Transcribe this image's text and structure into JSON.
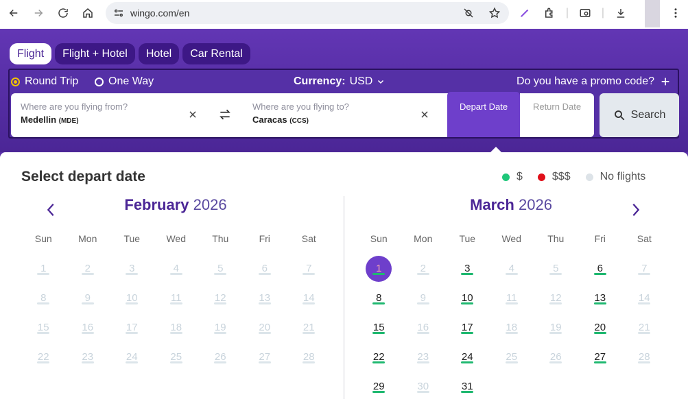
{
  "browser": {
    "url": "wingo.com/en"
  },
  "tabs": [
    {
      "label": "Flight",
      "active": true
    },
    {
      "label": "Flight + Hotel",
      "active": false
    },
    {
      "label": "Hotel",
      "active": false
    },
    {
      "label": "Car Rental",
      "active": false
    }
  ],
  "trip": {
    "round_trip": "Round Trip",
    "one_way": "One Way",
    "currency_label": "Currency:",
    "currency_value": "USD",
    "promo": "Do you have a promo code?"
  },
  "fields": {
    "from_placeholder": "Where are you flying from?",
    "from_city": "Medellin",
    "from_code": "(MDE)",
    "to_placeholder": "Where are you flying to?",
    "to_city": "Caracas",
    "to_code": "(CCS)",
    "depart": "Depart Date",
    "return": "Return Date",
    "search": "Search"
  },
  "calendar": {
    "title": "Select depart date",
    "legend": [
      "$",
      "$$$",
      "No flights"
    ],
    "legend_colors": [
      "#1fc77a",
      "#e0101a",
      "#dde3e8"
    ],
    "weekdays": [
      "Sun",
      "Mon",
      "Tue",
      "Wed",
      "Thu",
      "Fri",
      "Sat"
    ],
    "months": [
      {
        "name": "February",
        "year": "2026",
        "start_offset": 0,
        "days": 28,
        "available": [],
        "selected": null
      },
      {
        "name": "March",
        "year": "2026",
        "start_offset": 0,
        "days": 31,
        "available": [
          3,
          6,
          8,
          10,
          13,
          15,
          17,
          20,
          22,
          24,
          27,
          29,
          31
        ],
        "selected": 1
      }
    ]
  },
  "colors": {
    "brand_purple": "#5a2fa8",
    "accent_purple": "#6e3fcb",
    "available_green": "#1fb870"
  }
}
